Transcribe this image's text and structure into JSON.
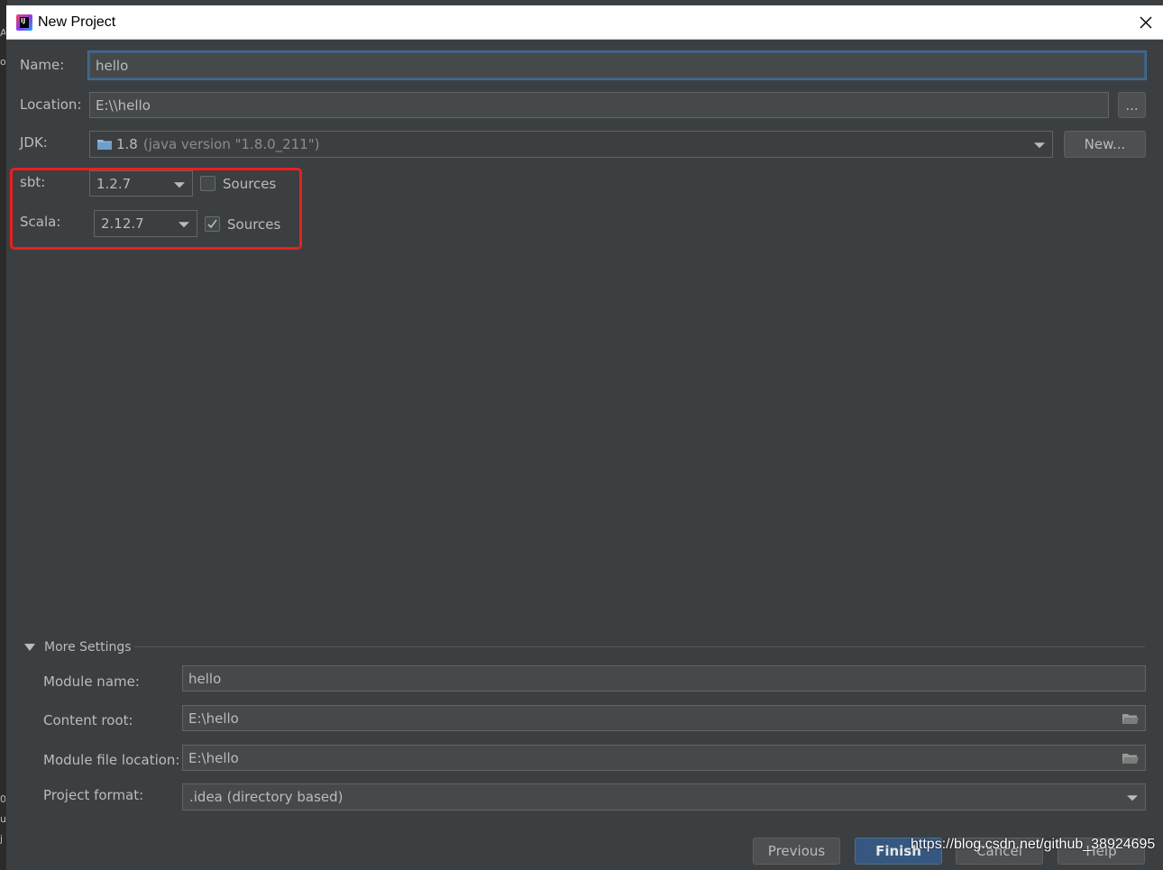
{
  "window": {
    "title": "New Project"
  },
  "form": {
    "name_label": "Name:",
    "name_value": "hello",
    "location_label": "Location:",
    "location_value": "E:\\\\hello",
    "browse_label": "...",
    "jdk_label": "JDK:",
    "jdk_version": "1.8",
    "jdk_detail": "(java version \"1.8.0_211\")",
    "jdk_new_label": "New...",
    "sbt_label": "sbt:",
    "sbt_version": "1.2.7",
    "sbt_sources_label": "Sources",
    "sbt_sources_checked": false,
    "scala_label": "Scala:",
    "scala_version": "2.12.7",
    "scala_sources_label": "Sources",
    "scala_sources_checked": true
  },
  "more_settings": {
    "header": "More Settings",
    "module_name_label": "Module name:",
    "module_name_value": "hello",
    "content_root_label": "Content root:",
    "content_root_value": "E:\\hello",
    "module_file_label": "Module file location:",
    "module_file_value": "E:\\hello",
    "project_format_label": "Project format:",
    "project_format_value": ".idea (directory based)"
  },
  "footer": {
    "previous_label": "Previous",
    "finish_label": "Finish",
    "cancel_label": "Cancel",
    "help_label": "Help"
  },
  "watermark": "https://blog.csdn.net/github_38924695",
  "colors": {
    "background": "#3c3f41",
    "field_bg": "#45494a",
    "focus": "#3d6185",
    "highlight": "#e8201f",
    "default_button": "#365880"
  }
}
